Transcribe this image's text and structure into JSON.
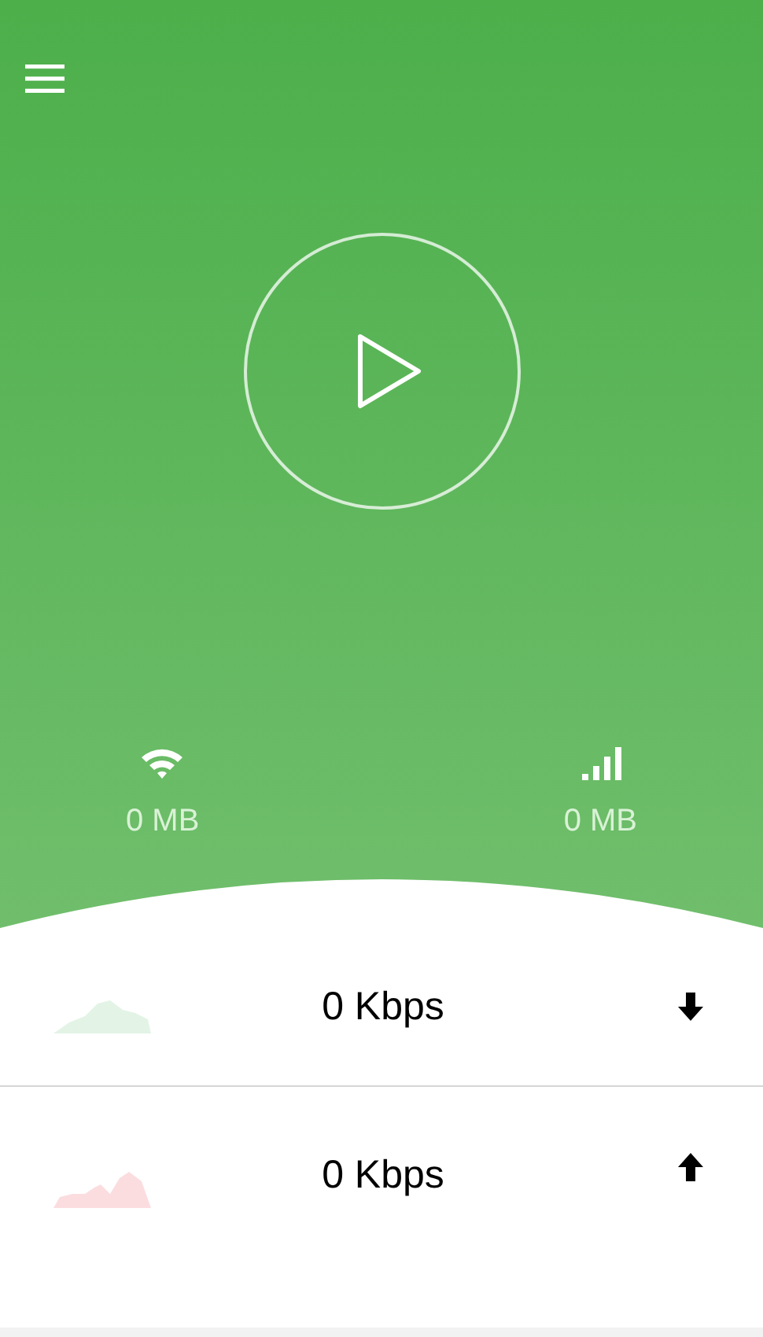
{
  "stats": [
    {
      "kind": "wifi",
      "amount": "0 MB"
    },
    {
      "kind": "cellular",
      "amount": "0 MB"
    }
  ],
  "rates": [
    {
      "kind": "download",
      "speed": "0 Kbps",
      "color": "#e3f4e6"
    },
    {
      "kind": "upload",
      "speed": "0 Kbps",
      "color": "#fbdde0"
    }
  ]
}
